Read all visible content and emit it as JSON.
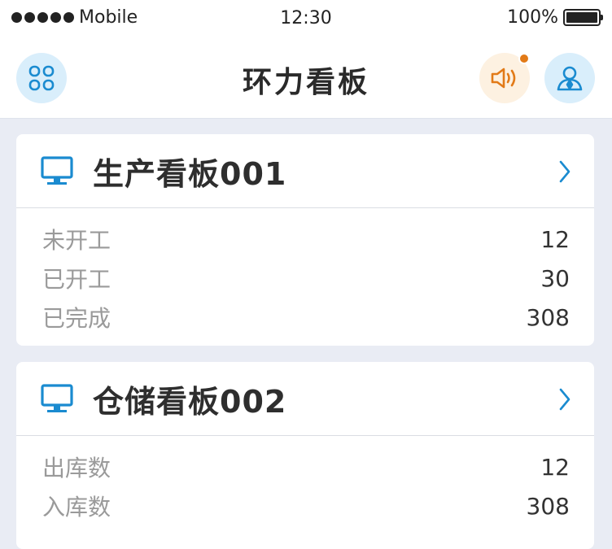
{
  "status_bar": {
    "carrier": "Mobile",
    "time": "12:30",
    "battery": "100%"
  },
  "nav": {
    "title": "环力看板",
    "menu_icon": "grid-icon",
    "sound_icon": "speaker-icon",
    "user_icon": "user-icon",
    "accent_color": "#1a8bd0",
    "badge_color": "#e27a17"
  },
  "cards": [
    {
      "title": "生产看板001",
      "rows": [
        {
          "label": "未开工",
          "value": "12"
        },
        {
          "label": "已开工",
          "value": "30"
        },
        {
          "label": "已完成",
          "value": "308"
        }
      ]
    },
    {
      "title": "仓储看板002",
      "rows": [
        {
          "label": "出库数",
          "value": "12"
        },
        {
          "label": "入库数",
          "value": "308"
        }
      ]
    }
  ]
}
